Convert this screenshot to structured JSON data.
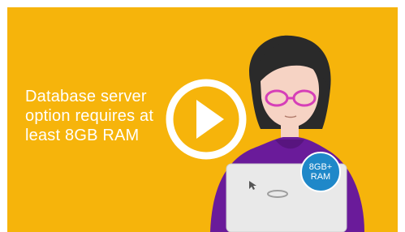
{
  "video": {
    "caption_lines": [
      "Database server",
      "option requires at",
      "least 8GB RAM"
    ],
    "badge_line1": "8GB+",
    "badge_line2": "RAM",
    "play_icon": "play-icon"
  },
  "colors": {
    "background": "#f6b40b",
    "caption_text": "#ffffff",
    "badge": "#1f88c9",
    "shirt": "#6a1b9a",
    "hair": "#2a2a2a",
    "glasses": "#d63fb8",
    "laptop": "#e9e9e9"
  }
}
